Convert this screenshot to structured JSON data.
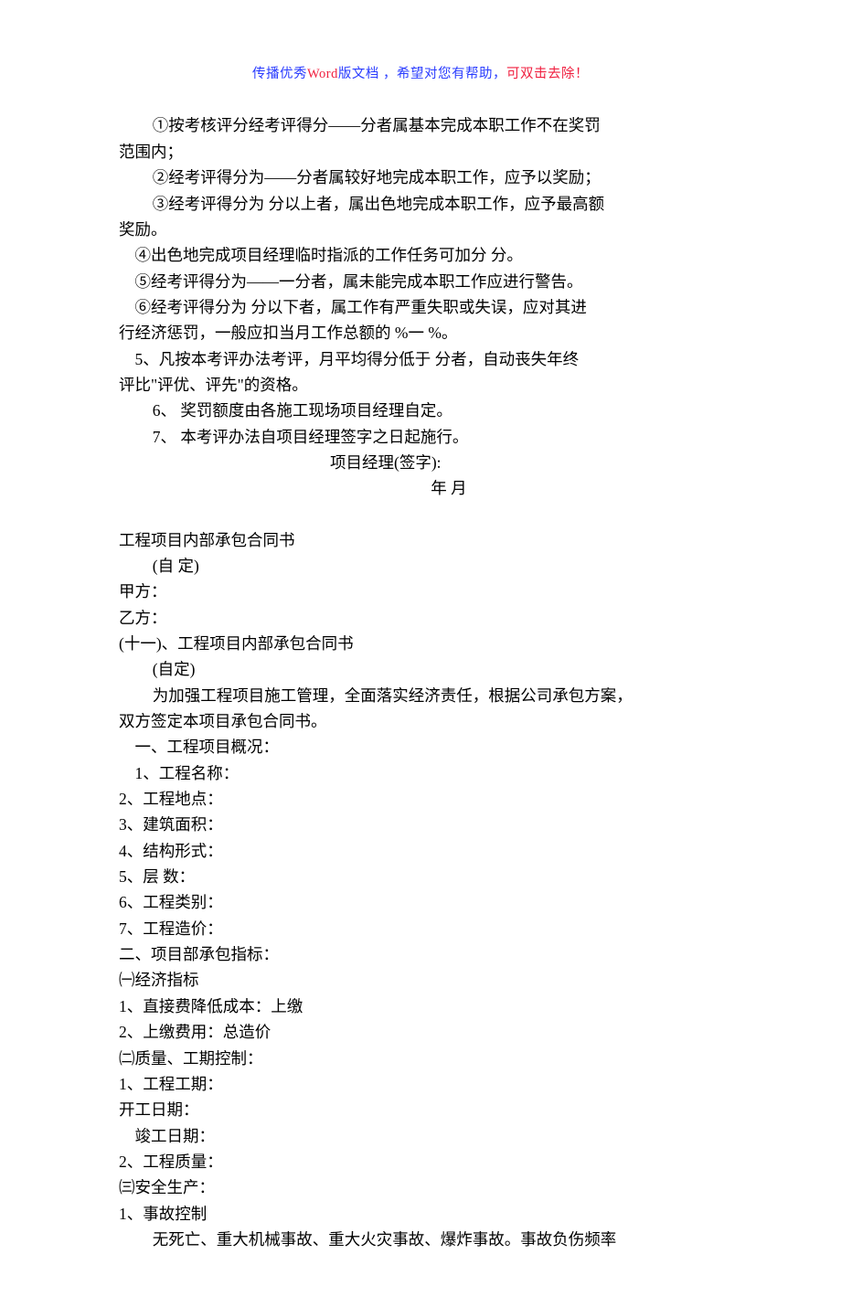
{
  "header": {
    "prefix": "传播优秀",
    "word": "Word",
    "mid": "版文档 ，希望对您有帮助，",
    "suffix": "可双击去除！"
  },
  "lines": {
    "l1": "①按考核评分经考评得分——分者属基本完成本职工作不在奖罚",
    "l2": "范围内；",
    "l3": "②经考评得分为——分者属较好地完成本职工作，应予以奖励；",
    "l4": "③经考评得分为   分以上者，属出色地完成本职工作，应予最高额",
    "l5": "奖励。",
    "l6": "④出色地完成项目经理临时指派的工作任务可加分      分。",
    "l7": "⑤经考评得分为——一分者，属未能完成本职工作应进行警告。",
    "l8": "⑥经考评得分为   分以下者，属工作有严重失职或失误，应对其进",
    "l9": "行经济惩罚，一般应扣当月工作总额的      %一       %。",
    "l10": "5、凡按本考评办法考评，月平均得分低于       分者，自动丧失年终",
    "l11": "评比\"评优、评先\"的资格。",
    "l12": "6、   奖罚额度由各施工现场项目经理自定。",
    "l13": "7、   本考评办法自项目经理签字之日起施行。",
    "l14": "项目经理(签字):",
    "l15": "年       月",
    "l16": "工程项目内部承包合同书",
    "l17": "(自    定)",
    "l18": "甲方：",
    "l19": "乙方：",
    "l20": "(十一)、工程项目内部承包合同书",
    "l21": "(自定)",
    "l22": "为加强工程项目施工管理，全面落实经济责任，根据公司承包方案，",
    "l23": "双方签定本项目承包合同书。",
    "l24": "一、工程项目概况：",
    "l25": "1、工程名称：",
    "l26": "2、工程地点：",
    "l27": "3、建筑面积：",
    "l28": "4、结构形式：",
    "l29": "5、层       数：",
    "l30": "6、工程类别：",
    "l31": "7、工程造价：",
    "l32": "二、项目部承包指标：",
    "l33": "㈠经济指标",
    "l34": "1、直接费降低成本：上缴",
    "l35": "2、上缴费用：总造价",
    "l36": "㈡质量、工期控制：",
    "l37": "1、工程工期：",
    "l38": "开工日期：",
    "l39": "竣工日期：",
    "l40": "2、工程质量：",
    "l41": "㈢安全生产：",
    "l42": "1、事故控制",
    "l43": "无死亡、重大机械事故、重大火灾事故、爆炸事故。事故负伤频率"
  }
}
